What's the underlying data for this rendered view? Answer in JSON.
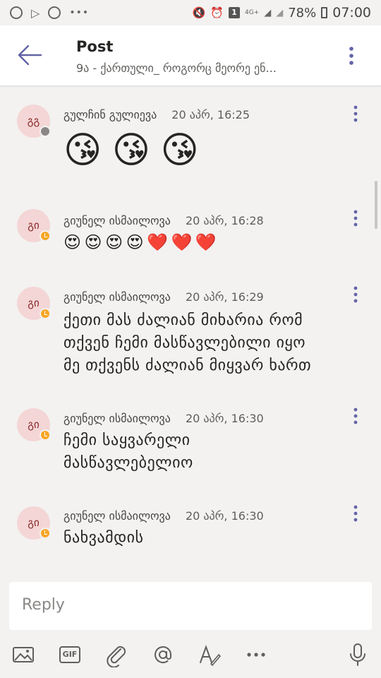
{
  "status_bar": {
    "battery": "78%",
    "time": "07:00",
    "network": "4G+",
    "sim": "1"
  },
  "header": {
    "title": "Post",
    "subtitle": "9ა - ქართული_ როგორც მეორე ენ..."
  },
  "messages": [
    {
      "initials": "გგ",
      "author": "გულჩინ გულიევა",
      "timestamp": "20 აპრ, 16:25",
      "presence": "offline",
      "emojis": [
        "😘",
        "😘",
        "😘"
      ]
    },
    {
      "initials": "გი",
      "author": "გიუნელ ისმაილოვა",
      "timestamp": "20 აპრ, 16:28",
      "presence": "away",
      "emojis": [
        "😍",
        "😍",
        "😍",
        "😍",
        "❤️",
        "❤️",
        "❤️"
      ]
    },
    {
      "initials": "გი",
      "author": "გიუნელ ისმაილოვა",
      "timestamp": "20 აპრ, 16:29",
      "presence": "away",
      "lines": [
        "ქეთი მას ძალიან მიხარია რომ",
        "თქვენ ჩემი მასწავლებილი იყო",
        "მე თქვენს ძალიან მიყვარ ხართ"
      ]
    },
    {
      "initials": "გი",
      "author": "გიუნელ ისმაილოვა",
      "timestamp": "20 აპრ, 16:30",
      "presence": "away",
      "lines": [
        "ჩემი საყვარელი",
        "მასწავლებელიო"
      ]
    },
    {
      "initials": "გი",
      "author": "გიუნელ ისმაილოვა",
      "timestamp": "20 აპრ, 16:30",
      "presence": "away",
      "lines": [
        "ნახვამდის"
      ]
    }
  ],
  "composer": {
    "placeholder": "Reply"
  },
  "toolbar": {
    "gif_label": "GIF"
  },
  "colors": {
    "accent": "#6264a7",
    "avatar_bg": "#f4d6d6",
    "away": "#f8a626",
    "offline": "#8a8886",
    "heart": "#d7262e"
  }
}
